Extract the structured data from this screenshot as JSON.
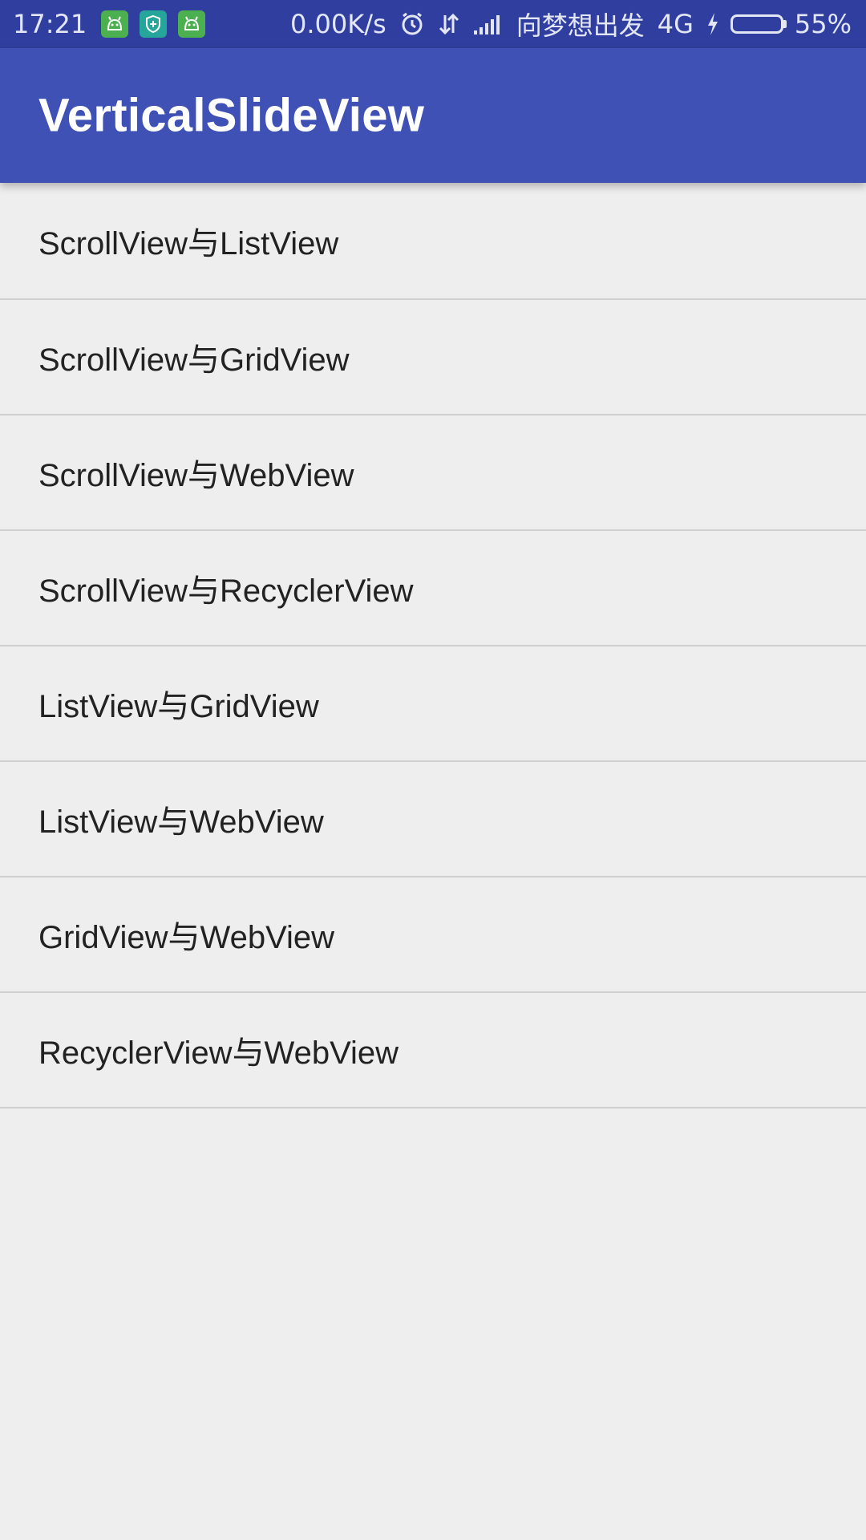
{
  "status_bar": {
    "time": "17:21",
    "net_speed": "0.00K/s",
    "carrier": "向梦想出发",
    "network_type": "4G",
    "battery": "55%",
    "battery_level": 0.55,
    "icons": [
      "android-app-icon",
      "shield-app-icon",
      "android-app-icon",
      "alarm-icon",
      "data-transfer-icon",
      "signal-icon",
      "charging-icon",
      "battery-icon"
    ],
    "colors": {
      "background": "#303f9f",
      "battery_fill": "#4cd137"
    }
  },
  "app_bar": {
    "title": "VerticalSlideView",
    "color": "#3f51b5"
  },
  "list": {
    "items": [
      {
        "label": "ScrollView与ListView"
      },
      {
        "label": "ScrollView与GridView"
      },
      {
        "label": "ScrollView与WebView"
      },
      {
        "label": "ScrollView与RecyclerView"
      },
      {
        "label": "ListView与GridView"
      },
      {
        "label": "ListView与WebView"
      },
      {
        "label": "GridView与WebView"
      },
      {
        "label": "RecyclerView与WebView"
      }
    ]
  }
}
